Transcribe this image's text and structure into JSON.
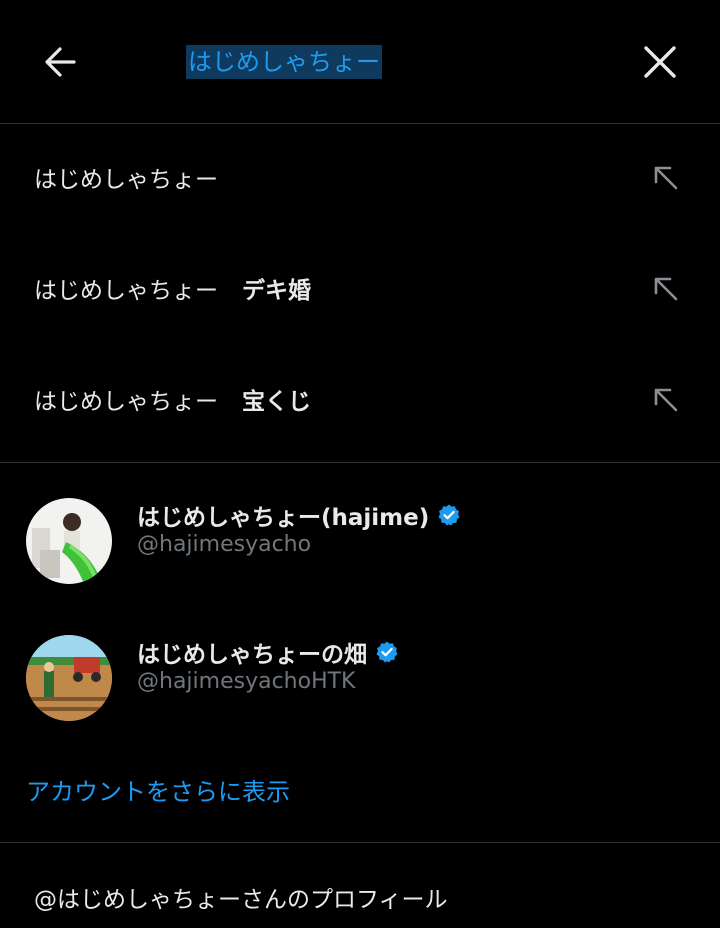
{
  "header": {
    "back_icon": "arrow-left-icon",
    "search_value": "はじめしゃちょー",
    "clear_icon": "close-icon"
  },
  "suggestions": [
    {
      "text": "はじめしゃちょー",
      "extra": "",
      "icon": "arrow-up-left-icon"
    },
    {
      "text": "はじめしゃちょー",
      "extra": "デキ婚",
      "icon": "arrow-up-left-icon"
    },
    {
      "text": "はじめしゃちょー",
      "extra": "宝くじ",
      "icon": "arrow-up-left-icon"
    }
  ],
  "accounts": [
    {
      "name": "はじめしゃちょー(hajime)",
      "handle": "@hajimesyacho",
      "verified": true
    },
    {
      "name": "はじめしゃちょーの畑",
      "handle": "@hajimesyachoHTK",
      "verified": true
    }
  ],
  "more_accounts_label": "アカウントをさらに表示",
  "profile_link": "@はじめしゃちょーさんのプロフィール",
  "colors": {
    "background": "#000000",
    "accent": "#1d9bf0",
    "text": "#e7e9ea",
    "muted": "#71767b",
    "divider": "#2f3336",
    "search_highlight": "#0f3a5e"
  }
}
